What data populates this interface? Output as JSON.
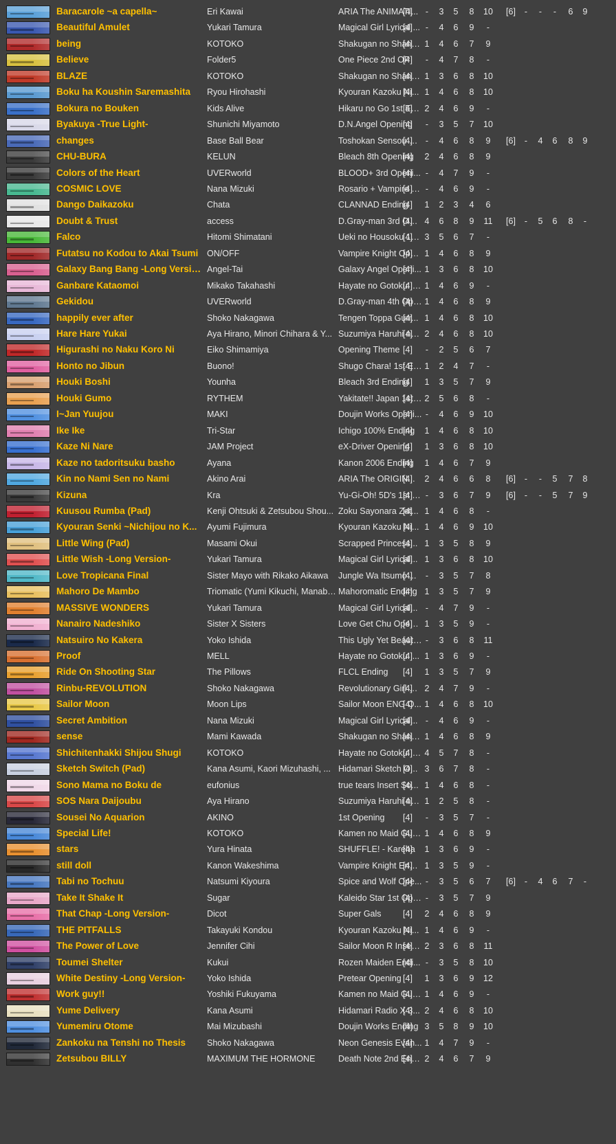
{
  "songs": [
    {
      "title": "Baracarole ~a capella~",
      "artist": "Eri Kawai",
      "source": "ARIA The ANIMATI...",
      "diff4": [
        "[4]",
        "-",
        "3",
        "5",
        "8",
        "10"
      ],
      "diff6": [
        "[6]",
        "-",
        "-",
        "-",
        "6",
        "9"
      ],
      "banner_color": "#5aa0d8"
    },
    {
      "title": "Beautiful Amulet",
      "artist": "Yukari Tamura",
      "source": "Magical Girl Lyrical ...",
      "diff4": [
        "[4]",
        "-",
        "4",
        "6",
        "9",
        "-"
      ],
      "banner_color": "#3a58b0"
    },
    {
      "title": "being",
      "artist": "KOTOKO",
      "source": "Shakugan no Shana...",
      "diff4": [
        "[4]",
        "1",
        "4",
        "6",
        "7",
        "9"
      ],
      "banner_color": "#b02a2a"
    },
    {
      "title": "Believe",
      "artist": "Folder5",
      "source": "One Piece 2nd OP",
      "diff4": [
        "[4]",
        "-",
        "4",
        "7",
        "8",
        "-"
      ],
      "banner_color": "#d8c040"
    },
    {
      "title": "BLAZE",
      "artist": "KOTOKO",
      "source": "Shakugan no Shana ...",
      "diff4": [
        "[4]",
        "1",
        "3",
        "6",
        "8",
        "10"
      ],
      "banner_color": "#c03a28"
    },
    {
      "title": "Boku ha Koushin Saremashita",
      "artist": "Ryou Hirohashi",
      "source": "Kyouran Kazoku Ni...",
      "diff4": [
        "[4]",
        "1",
        "4",
        "6",
        "8",
        "10"
      ],
      "banner_color": "#5a9ad0"
    },
    {
      "title": "Bokura no Bouken",
      "artist": "Kids Alive",
      "source": "Hikaru no Go 1st En...",
      "diff4": [
        "[4]",
        "2",
        "4",
        "6",
        "9",
        "-"
      ],
      "banner_color": "#3a70c8"
    },
    {
      "title": "Byakuya -True Light-",
      "artist": "Shunichi Miyamoto",
      "source": "D.N.Angel Opening",
      "diff4": [
        "[4]",
        "-",
        "3",
        "5",
        "7",
        "10"
      ],
      "banner_color": "#d8d8e8"
    },
    {
      "title": "changes",
      "artist": "Base Ball Bear",
      "source": "Toshokan Sensou O...",
      "diff4": [
        "[4]",
        "-",
        "4",
        "6",
        "8",
        "9"
      ],
      "diff6": [
        "[6]",
        "-",
        "4",
        "6",
        "8",
        "9"
      ],
      "banner_color": "#4a6ab8"
    },
    {
      "title": "Bleach 8th Opening",
      "artist": "",
      "source": "",
      "hidden": true,
      "diff4": [],
      "banner_color": "#404040"
    },
    {
      "title": "Colors of the Heart",
      "artist": "UVERworld",
      "source": "BLOOD+ 3rd Openi...",
      "diff4": [
        "[4]",
        "-",
        "4",
        "7",
        "9",
        "-"
      ],
      "banner_color": "#3a3a3a"
    },
    {
      "title": "COSMIC LOVE",
      "artist": "Nana Mizuki",
      "source": "Rosario + Vampire O...",
      "diff4": [
        "[4]",
        "-",
        "4",
        "6",
        "9",
        "-"
      ],
      "banner_color": "#48b890"
    },
    {
      "title": "Dango Daikazoku",
      "artist": "Chata",
      "source": "CLANNAD Ending",
      "diff4": [
        "[4]",
        "1",
        "2",
        "3",
        "4",
        "6"
      ],
      "banner_color": "#e0e0e0"
    },
    {
      "title": "Doubt & Trust",
      "artist": "access",
      "source": "D.Gray-man 3rd Ope...",
      "diff4": [
        "[4]",
        "4",
        "6",
        "8",
        "9",
        "11"
      ],
      "diff6": [
        "[6]",
        "-",
        "5",
        "6",
        "8",
        "-"
      ],
      "banner_color": "#e8e8e8"
    },
    {
      "title": "Falco",
      "artist": "Hitomi Shimatani",
      "source": "Ueki no Housoku 1st ...",
      "diff4": [
        "[4]",
        "3",
        "5",
        "6",
        "7",
        "-"
      ],
      "banner_color": "#48b838"
    },
    {
      "title": "Futatsu no Kodou to Akai Tsumi",
      "artist": "ON/OFF",
      "source": "Vampire Knight Ope...",
      "diff4": [
        "[4]",
        "1",
        "4",
        "6",
        "8",
        "9"
      ],
      "banner_color": "#a02828"
    },
    {
      "title": "Galaxy Bang Bang -Long Versio...",
      "artist": "Angel-Tai",
      "source": "Galaxy Angel Openi...",
      "diff4": [
        "[4]",
        "1",
        "3",
        "6",
        "8",
        "10"
      ],
      "banner_color": "#d86090"
    },
    {
      "title": "Ganbare Kataomoi",
      "artist": "Mikako Takahashi",
      "source": "Hayate no Gotoku! -...",
      "diff4": [
        "[4]",
        "1",
        "4",
        "6",
        "9",
        "-"
      ],
      "banner_color": "#e8b8d8"
    },
    {
      "title": "Gekidou",
      "artist": "UVERworld",
      "source": "D.Gray-man 4th Ope...",
      "diff4": [
        "[4]",
        "1",
        "4",
        "6",
        "8",
        "9"
      ],
      "banner_color": "#607890"
    },
    {
      "title": "happily ever after",
      "artist": "Shoko Nakagawa",
      "source": "Tengen Toppa Gurr...",
      "diff4": [
        "[4]",
        "1",
        "4",
        "6",
        "8",
        "10"
      ],
      "banner_color": "#3868c0"
    },
    {
      "title": "Hare Hare Yukai",
      "artist": "Aya Hirano, Minori Chihara & Y...",
      "source": "Suzumiya Haruhi no ...",
      "diff4": [
        "[4]",
        "2",
        "4",
        "6",
        "8",
        "10"
      ],
      "banner_color": "#c8d0f0"
    },
    {
      "title": "Higurashi no Naku Koro Ni",
      "artist": "Eiko Shimamiya",
      "source": "Opening Theme",
      "diff4": [
        "[4]",
        "-",
        "2",
        "5",
        "6",
        "7"
      ],
      "banner_color": "#c02828"
    },
    {
      "title": "Honto no Jibun",
      "artist": "Buono!",
      "source": "Shugo Chara! 1st En...",
      "diff4": [
        "[4]",
        "1",
        "2",
        "4",
        "7",
        "-"
      ],
      "banner_color": "#e060a0"
    },
    {
      "title": "Houki Boshi",
      "artist": "Younha",
      "source": "Bleach 3rd Ending",
      "diff4": [
        "[4]",
        "1",
        "3",
        "5",
        "7",
        "9"
      ],
      "banner_color": "#d8a070"
    },
    {
      "title": "Houki Gumo",
      "artist": "RYTHEM",
      "source": "Yakitate!! Japan 1st ...",
      "diff4": [
        "[4]",
        "2",
        "5",
        "6",
        "8",
        "-"
      ],
      "banner_color": "#e8a050"
    },
    {
      "title": "I~Jan Yuujou",
      "artist": "MAKI",
      "source": "Doujin Works Openi...",
      "diff4": [
        "[4]",
        "-",
        "4",
        "6",
        "9",
        "10"
      ],
      "banner_color": "#5090e0"
    },
    {
      "title": "Ike Ike",
      "artist": "Tri-Star",
      "source": "Ichigo 100% Ending",
      "diff4": [
        "[4]",
        "1",
        "4",
        "6",
        "8",
        "10"
      ],
      "banner_color": "#e080b0"
    },
    {
      "title": "Kaze Ni Nare",
      "artist": "JAM Project",
      "source": "eX-Driver Opening",
      "diff4": [
        "[4]",
        "1",
        "3",
        "6",
        "8",
        "10"
      ],
      "banner_color": "#3870d0"
    },
    {
      "title": "Kaze no tadoritsuku basho",
      "artist": "Ayana",
      "source": "Kanon 2006 Ending",
      "diff4": [
        "[4]",
        "1",
        "4",
        "6",
        "7",
        "9"
      ],
      "banner_color": "#c8b8e8"
    },
    {
      "title": "Kin no Nami Sen no Nami",
      "artist": "Akino Arai",
      "source": "ARIA The ORIGIN...",
      "diff4": [
        "[4]",
        "2",
        "4",
        "6",
        "6",
        "8"
      ],
      "diff6": [
        "[6]",
        "-",
        "-",
        "5",
        "7",
        "8"
      ],
      "banner_color": "#50a8e0"
    },
    {
      "title": "Kizuna",
      "artist": "Kra",
      "source": "Yu-Gi-Oh! 5D's 1st O...",
      "diff4": [
        "[4]",
        "-",
        "3",
        "6",
        "7",
        "9"
      ],
      "diff6": [
        "[6]",
        "-",
        "-",
        "5",
        "7",
        "9"
      ],
      "banner_color": "#3a3a3a"
    },
    {
      "title": "Kuusou Rumba (Pad)",
      "artist": "Kenji Ohtsuki & Zetsubou Shou...",
      "source": "Zoku Sayonara Zet...",
      "diff4": [
        "[4]",
        "1",
        "4",
        "6",
        "8",
        "-"
      ],
      "banner_color": "#c02030"
    },
    {
      "title": "Kyouran Senki ~Nichijou no K...",
      "artist": "Ayumi Fujimura",
      "source": "Kyouran Kazoku Ni...",
      "diff4": [
        "[4]",
        "1",
        "4",
        "6",
        "9",
        "10"
      ],
      "banner_color": "#48a0d8"
    },
    {
      "title": "Little Wing (Pad)",
      "artist": "Masami Okui",
      "source": "Scrapped Princess...",
      "diff4": [
        "[4]",
        "1",
        "3",
        "5",
        "8",
        "9"
      ],
      "banner_color": "#e0c080"
    },
    {
      "title": "Little Wish -Long Version-",
      "artist": "Yukari Tamura",
      "source": "Magical Girl Lyrical...",
      "diff4": [
        "[4]",
        "1",
        "3",
        "6",
        "8",
        "10"
      ],
      "banner_color": "#e05050"
    },
    {
      "title": "Love Tropicana Final",
      "artist": "Sister Mayo with Rikako Aikawa",
      "source": "Jungle Wa Itsumo ...",
      "diff4": [
        "[4]",
        "-",
        "3",
        "5",
        "7",
        "8"
      ],
      "banner_color": "#50b8c8"
    },
    {
      "title": "Mahoro De Mambo",
      "artist": "Triomatic (Yumi Kikuchi, Manabi ...",
      "source": "Mahoromatic Ending",
      "diff4": [
        "[4]",
        "1",
        "3",
        "5",
        "7",
        "9"
      ],
      "banner_color": "#e8c060"
    },
    {
      "title": "MASSIVE WONDERS",
      "artist": "Yukari Tamura",
      "source": "Magical Girl Lyrical...",
      "diff4": [
        "[4]",
        "-",
        "4",
        "7",
        "9",
        "-"
      ],
      "banner_color": "#e08030"
    },
    {
      "title": "Nanairo Nadeshiko",
      "artist": "Sister X Sisters",
      "source": "Love Get Chu Openi...",
      "diff4": [
        "[4]",
        "1",
        "3",
        "5",
        "9",
        "-"
      ],
      "banner_color": "#f0b0d0"
    },
    {
      "title": "Natsuiro No Kakera",
      "artist": "Yoko Ishida",
      "source": "This Ugly Yet Beauti...",
      "diff4": [
        "[4]",
        "-",
        "3",
        "6",
        "8",
        "11"
      ],
      "banner_color": "#1a2a4a"
    },
    {
      "title": "Proof",
      "artist": "MELL",
      "source": "Hayate no Gotoku! ...",
      "diff4": [
        "[4]",
        "1",
        "3",
        "6",
        "9",
        "-"
      ],
      "banner_color": "#d87030"
    },
    {
      "title": "Ride On Shooting Star",
      "artist": "The Pillows",
      "source": "FLCL Ending",
      "diff4": [
        "[4]",
        "1",
        "3",
        "5",
        "7",
        "9"
      ],
      "banner_color": "#e8a030"
    },
    {
      "title": "Rinbu-REVOLUTION",
      "artist": "Shoko Nakagawa",
      "source": "Revolutionary Girl U...",
      "diff4": [
        "[4]",
        "2",
        "4",
        "7",
        "9",
        "-"
      ],
      "banner_color": "#c050a0"
    },
    {
      "title": "Sailor Moon",
      "artist": "Moon Lips",
      "source": "Sailor Moon ENG O...",
      "diff4": [
        "[4]",
        "1",
        "4",
        "6",
        "8",
        "10"
      ],
      "banner_color": "#e8c848"
    },
    {
      "title": "Secret Ambition",
      "artist": "Nana Mizuki",
      "source": "Magical Girl Lyrical...",
      "diff4": [
        "[4]",
        "-",
        "4",
        "6",
        "9",
        "-"
      ],
      "banner_color": "#3050a0"
    },
    {
      "title": "sense",
      "artist": "Mami Kawada",
      "source": "Shakugan no Shana ...",
      "diff4": [
        "[4]",
        "1",
        "4",
        "6",
        "8",
        "9"
      ],
      "banner_color": "#a02820"
    },
    {
      "title": "Shichitenhakki Shijou Shugi",
      "artist": "KOTOKO",
      "source": "Hayate no Gotoku! 2...",
      "diff4": [
        "[4]",
        "4",
        "5",
        "7",
        "8",
        "-"
      ],
      "banner_color": "#5878d0"
    },
    {
      "title": "Sketch Switch (Pad)",
      "artist": "Kana Asumi, Kaori Mizuhashi, ...",
      "source": "Hidamari Sketch O...",
      "diff4": [
        "[4]",
        "3",
        "6",
        "7",
        "8",
        "-"
      ],
      "banner_color": "#c8d0e0"
    },
    {
      "title": "Sono Mama no Boku de",
      "artist": "eufonius",
      "source": "true tears Insert So...",
      "diff4": [
        "[4]",
        "1",
        "4",
        "6",
        "8",
        "-"
      ],
      "banner_color": "#f0d8e8"
    },
    {
      "title": "SOS Nara Daijoubu",
      "artist": "Aya Hirano",
      "source": "Suzumiya Haruhi no ...",
      "diff4": [
        "[4]",
        "1",
        "2",
        "5",
        "8",
        "-"
      ],
      "banner_color": "#d84848"
    },
    {
      "title": "Sousei No Aquarion",
      "artist": "AKINO",
      "source": "1st Opening",
      "diff4": [
        "[4]",
        "-",
        "3",
        "5",
        "7",
        "-"
      ],
      "banner_color": "#282838"
    },
    {
      "title": "Special Life!",
      "artist": "KOTOKO",
      "source": "Kamen no Maid Guy...",
      "diff4": [
        "[4]",
        "1",
        "4",
        "6",
        "8",
        "9"
      ],
      "banner_color": "#4888d8"
    },
    {
      "title": "stars",
      "artist": "Yura Hinata",
      "source": "SHUFFLE! - Kareha",
      "diff4": [
        "[4]",
        "1",
        "3",
        "6",
        "9",
        "-"
      ],
      "banner_color": "#e89030"
    },
    {
      "title": "still doll",
      "artist": "Kanon Wakeshima",
      "source": "Vampire Knight Endi...",
      "diff4": [
        "[4]",
        "1",
        "3",
        "5",
        "9",
        "-"
      ],
      "banner_color": "#282828"
    },
    {
      "title": "Tabi no Tochuu",
      "artist": "Natsumi Kiyoura",
      "source": "Spice and Wolf Ope...",
      "diff4": [
        "[4]",
        "-",
        "3",
        "5",
        "6",
        "7"
      ],
      "diff6": [
        "[6]",
        "-",
        "4",
        "6",
        "7",
        "-"
      ],
      "banner_color": "#4878c0"
    },
    {
      "title": "Take It Shake It",
      "artist": "Sugar",
      "source": "Kaleido Star 1st Ope...",
      "diff4": [
        "[4]",
        "-",
        "3",
        "5",
        "7",
        "9"
      ],
      "banner_color": "#e8a8c8"
    },
    {
      "title": "That Chap -Long Version-",
      "artist": "Dicot",
      "source": "Super Gals",
      "diff4": [
        "[4]",
        "2",
        "4",
        "6",
        "8",
        "9"
      ],
      "banner_color": "#e870a8"
    },
    {
      "title": "THE PITFALLS",
      "artist": "Takayuki Kondou",
      "source": "Kyouran Kazoku Ni...",
      "diff4": [
        "[4]",
        "1",
        "4",
        "6",
        "9",
        "-"
      ],
      "banner_color": "#3868b8"
    },
    {
      "title": "The Power of Love",
      "artist": "Jennifer Cihi",
      "source": "Sailor Moon R Insert ...",
      "diff4": [
        "[4]",
        "2",
        "3",
        "6",
        "8",
        "11"
      ],
      "banner_color": "#d050a0"
    },
    {
      "title": "Toumei Shelter",
      "artist": "Kukui",
      "source": "Rozen Maiden Endi...",
      "diff4": [
        "[4]",
        "-",
        "3",
        "5",
        "8",
        "10"
      ],
      "banner_color": "#304068"
    },
    {
      "title": "White Destiny -Long Version-",
      "artist": "Yoko Ishida",
      "source": "Pretear Opening",
      "diff4": [
        "[4]",
        "1",
        "3",
        "6",
        "9",
        "12"
      ],
      "banner_color": "#e8d0e0"
    },
    {
      "title": "Work guy!!",
      "artist": "Yoshiki Fukuyama",
      "source": "Kamen no Maid Guy ...",
      "diff4": [
        "[4]",
        "1",
        "4",
        "6",
        "9",
        "-"
      ],
      "banner_color": "#c03030"
    },
    {
      "title": "Yume Delivery",
      "artist": "Kana Asumi",
      "source": "Hidamari Radio X 3...",
      "diff4": [
        "[4]",
        "2",
        "4",
        "6",
        "8",
        "10"
      ],
      "banner_color": "#e8e0c0"
    },
    {
      "title": "Yumemiru Otome",
      "artist": "Mai Mizubashi",
      "source": "Doujin Works Ending",
      "diff4": [
        "[4]",
        "3",
        "5",
        "8",
        "9",
        "10"
      ],
      "banner_color": "#5090e0"
    },
    {
      "title": "Zankoku na Tenshi no Thesis",
      "artist": "Shoko Nakagawa",
      "source": "Neon Genesis Evan...",
      "diff4": [
        "[4]",
        "1",
        "4",
        "7",
        "9",
        "-"
      ],
      "banner_color": "#202838"
    },
    {
      "title": "Zetsubou BILLY",
      "artist": "MAXIMUM THE HORMONE",
      "source": "Death Note 2nd Endi...",
      "diff4": [
        "[4]",
        "2",
        "4",
        "6",
        "7",
        "9"
      ],
      "banner_color": "#303030"
    }
  ]
}
